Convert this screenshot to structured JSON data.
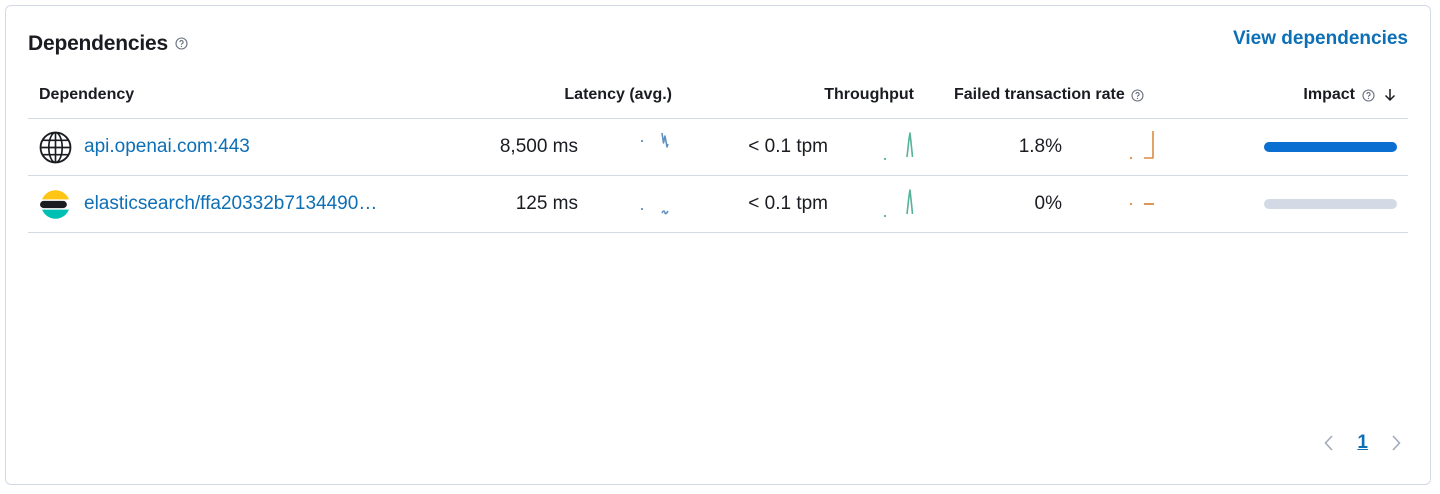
{
  "panel": {
    "title": "Dependencies",
    "view_link": "View dependencies"
  },
  "table": {
    "columns": {
      "dependency": "Dependency",
      "latency": "Latency (avg.)",
      "throughput": "Throughput",
      "failed_rate": "Failed transaction rate",
      "impact": "Impact"
    },
    "sort": {
      "column": "impact",
      "direction": "desc"
    },
    "rows": [
      {
        "icon": "globe-icon",
        "name": "api.openai.com:443",
        "latency": "8,500 ms",
        "throughput": "< 0.1 tpm",
        "failed_rate": "1.8%",
        "impact": 1.0
      },
      {
        "icon": "elasticsearch-icon",
        "name": "elasticsearch/ffa20332b7134490…",
        "latency": "125 ms",
        "throughput": "< 0.1 tpm",
        "failed_rate": "0%",
        "impact": 0.0
      }
    ]
  },
  "pagination": {
    "current_page": "1"
  },
  "colors": {
    "link": "#0d6fb5",
    "latency_spark": "#6092c0",
    "throughput_spark": "#54b399",
    "failed_spark": "#da8b45",
    "impact_fill": "#0b6fd1",
    "impact_track": "#d3dae6"
  }
}
